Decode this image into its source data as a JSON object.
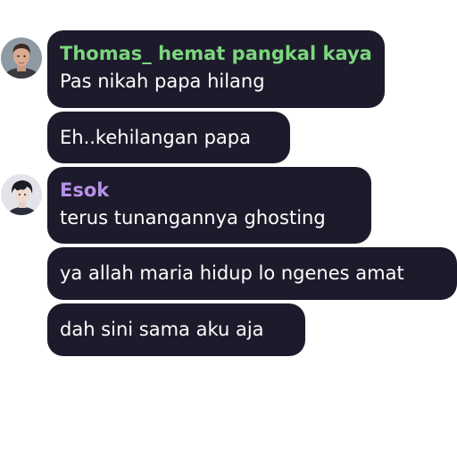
{
  "chat": {
    "messages": [
      {
        "sender": "Thomas_ hemat pangkal kaya",
        "text": "Pas nikah papa hilang"
      },
      {
        "text": "Eh..kehilangan papa"
      },
      {
        "sender": "Esok",
        "text": "terus tunangannya ghosting"
      },
      {
        "text": "ya allah maria hidup lo ngenes amat"
      },
      {
        "text": "dah sini sama aku aja"
      }
    ]
  },
  "colors": {
    "bubble": "#1d1b2b",
    "message_text": "#ffffff",
    "sender_thomas": "#7cd67e",
    "sender_esok": "#b792ea",
    "background": "#ffffff"
  },
  "icons": {
    "avatar_thomas": "avatar-photo-man",
    "avatar_esok": "avatar-photo-anime-boy"
  }
}
